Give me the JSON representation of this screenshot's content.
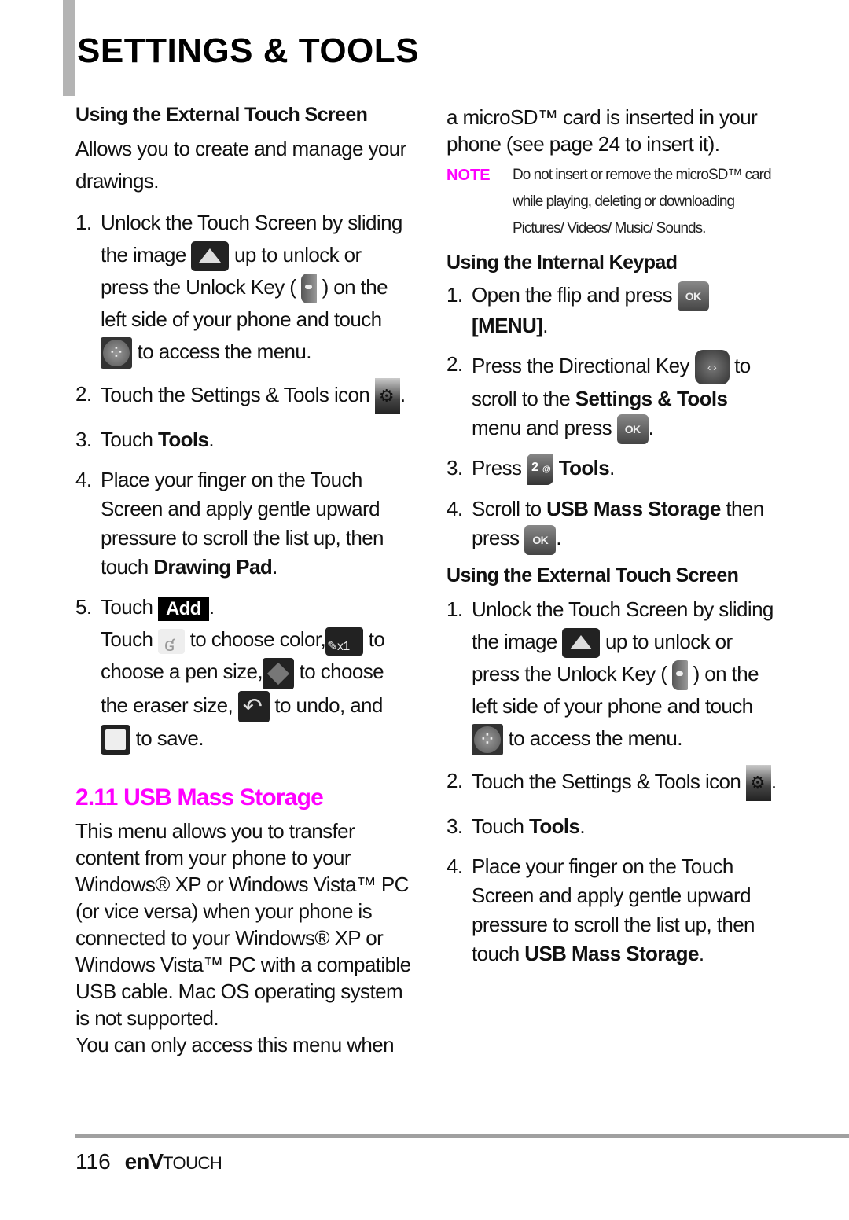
{
  "page": {
    "title": "SETTINGS & TOOLS",
    "page_number": "116",
    "brand": {
      "part1": "enV",
      "part2": "TOUCH"
    }
  },
  "colors": {
    "accent": "#ff00ff",
    "sidebar_bar": "#b4b4b4",
    "footer_rule": "#a0a0a0"
  },
  "left": {
    "heading": "Using the External Touch Screen",
    "intro": "Allows you to create and manage your drawings.",
    "steps": [
      {
        "num": "1.",
        "parts": [
          "Unlock the Touch Screen by sliding the image",
          "up to unlock or press the Unlock Key (",
          ") on the left side of your phone and touch",
          "to access the menu."
        ]
      },
      {
        "num": "2.",
        "text": "Touch the Settings & Tools icon",
        "after": "."
      },
      {
        "num": "3.",
        "text": "Touch ",
        "bold": "Tools",
        "after": "."
      },
      {
        "num": "4.",
        "text": "Place your finger on the Touch Screen and apply gentle upward pressure to scroll the list up, then touch ",
        "bold": "Drawing Pad",
        "after": "."
      },
      {
        "num": "5.",
        "text": "Touch",
        "button": "Add",
        "after": ".",
        "detail": [
          "Touch",
          "to choose color,",
          "to choose a pen size,",
          "to choose the eraser size,",
          "to undo, and",
          "to save."
        ]
      }
    ],
    "section_title": "2.11 USB Mass Storage",
    "section_body": "This menu allows you to transfer content from your phone to your Windows® XP or Windows Vista™ PC (or vice versa) when your phone is connected to your Windows® XP or Windows Vista™ PC with a compatible USB cable. Mac OS operating system is not supported.",
    "section_body2": "You can only access this menu when"
  },
  "right": {
    "continued": "a microSD™ card is inserted in your phone (see page 24 to insert it).",
    "note_label": "NOTE",
    "note_text": "Do not insert or remove the microSD™ card while playing, deleting or downloading Pictures/ Videos/ Music/ Sounds.",
    "keypad_heading": "Using the Internal Keypad",
    "keypad_steps": [
      {
        "num": "1.",
        "text": "Open the flip and press",
        "bold": "[MENU]",
        "after": "."
      },
      {
        "num": "2.",
        "text": "Press the Directional Key",
        "mid": "to scroll to the ",
        "bold": "Settings & Tools",
        "after": "menu and press",
        "end": "."
      },
      {
        "num": "3.",
        "text": "Press",
        "bold": "Tools",
        "after": "."
      },
      {
        "num": "4.",
        "text": "Scroll to ",
        "bold": "USB Mass Storage",
        "mid": " then press",
        "after": "."
      }
    ],
    "touch_heading": "Using the External Touch Screen",
    "touch_steps": [
      {
        "num": "1.",
        "parts": [
          "Unlock the Touch Screen by sliding the image",
          "up to unlock or press the Unlock Key (",
          ") on the left side of your phone and touch",
          "to access the menu."
        ]
      },
      {
        "num": "2.",
        "text": "Touch the Settings & Tools icon",
        "after": "."
      },
      {
        "num": "3.",
        "text": "Touch ",
        "bold": "Tools",
        "after": "."
      },
      {
        "num": "4.",
        "text": "Place your finger on the Touch Screen and apply gentle upward pressure to scroll the list up, then touch ",
        "bold": "USB Mass Storage",
        "after": "."
      }
    ],
    "icons": {
      "ok_label": "OK",
      "key2_label": "2",
      "key2_sup": "@",
      "dir_label": "‹ ›"
    }
  }
}
